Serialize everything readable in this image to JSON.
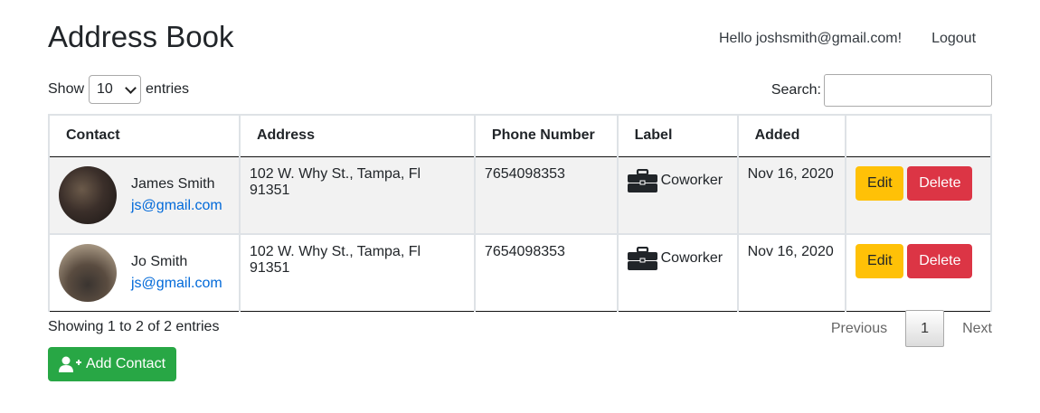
{
  "header": {
    "title": "Address Book",
    "greeting": "Hello joshsmith@gmail.com!",
    "logout_label": "Logout"
  },
  "controls": {
    "show_label": "Show",
    "entries_label": "entries",
    "page_size": "10",
    "search_label": "Search:",
    "search_value": ""
  },
  "table": {
    "columns": [
      "Contact",
      "Address",
      "Phone Number",
      "Label",
      "Added",
      ""
    ],
    "rows": [
      {
        "name": "James Smith",
        "email": "js@gmail.com",
        "address": "102 W. Why St., Tampa, Fl 91351",
        "phone": "7654098353",
        "label": "Coworker",
        "label_icon": "briefcase-icon",
        "added": "Nov 16, 2020",
        "edit_label": "Edit",
        "delete_label": "Delete"
      },
      {
        "name": "Jo Smith",
        "email": "js@gmail.com",
        "address": "102 W. Why St., Tampa, Fl 91351",
        "phone": "7654098353",
        "label": "Coworker",
        "label_icon": "briefcase-icon",
        "added": "Nov 16, 2020",
        "edit_label": "Edit",
        "delete_label": "Delete"
      }
    ]
  },
  "footer": {
    "info": "Showing 1 to 2 of 2 entries",
    "previous_label": "Previous",
    "current_page": "1",
    "next_label": "Next",
    "add_contact_label": "Add Contact",
    "add_contact_icon": "user-plus-icon"
  },
  "colors": {
    "edit": "#ffc107",
    "delete": "#dc3545",
    "add": "#28a745",
    "link": "#0069d9"
  }
}
